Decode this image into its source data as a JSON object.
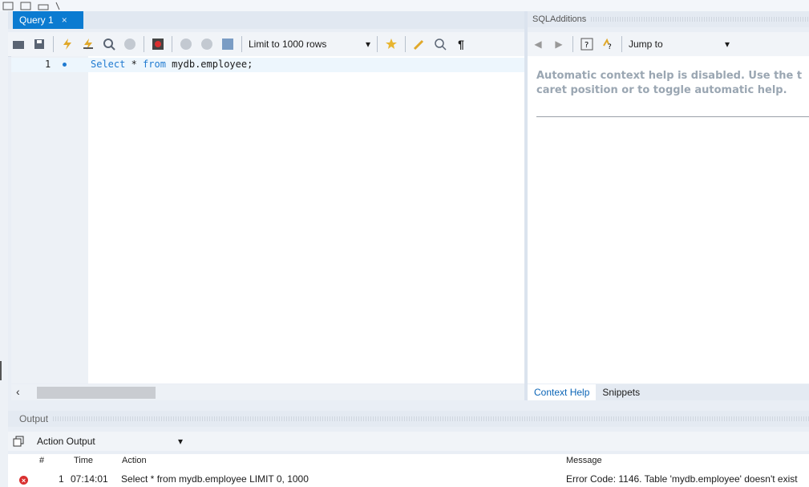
{
  "editor": {
    "tab_label": "Query 1",
    "tab_close": "×",
    "line_number": "1",
    "code_keyword_select": "Select",
    "code_star": " * ",
    "code_keyword_from": "from",
    "code_rest": " mydb.employee;"
  },
  "toolbar": {
    "limit_label": "Limit to 1000 rows",
    "icons": [
      "open-folder-icon",
      "save-icon",
      "execute-icon",
      "execute-current-icon",
      "explain-icon",
      "stop-icon",
      "toggle-error-icon",
      "commit-icon",
      "rollback-icon",
      "autocommit-icon",
      "add-snippet-icon",
      "beautify-icon",
      "find-icon",
      "invisible-chars-icon"
    ]
  },
  "sql_additions": {
    "title": "SQLAdditions",
    "jump_label": "Jump to",
    "help_line1": "Automatic context help is disabled. Use the t",
    "help_line2": "caret position or to toggle automatic help.",
    "tabs": [
      "Context Help",
      "Snippets"
    ]
  },
  "output": {
    "title": "Output",
    "selector": "Action Output",
    "columns": {
      "num": "#",
      "time": "Time",
      "action": "Action",
      "message": "Message"
    },
    "rows": [
      {
        "num": "1",
        "time": "07:14:01",
        "action": "Select * from mydb.employee LIMIT 0, 1000",
        "message": "Error Code: 1146. Table 'mydb.employee' doesn't exist",
        "status": "error"
      }
    ]
  },
  "colors": {
    "accent": "#0b7bd1",
    "keyword": "#1f7ad1",
    "error": "#d92f2f"
  }
}
